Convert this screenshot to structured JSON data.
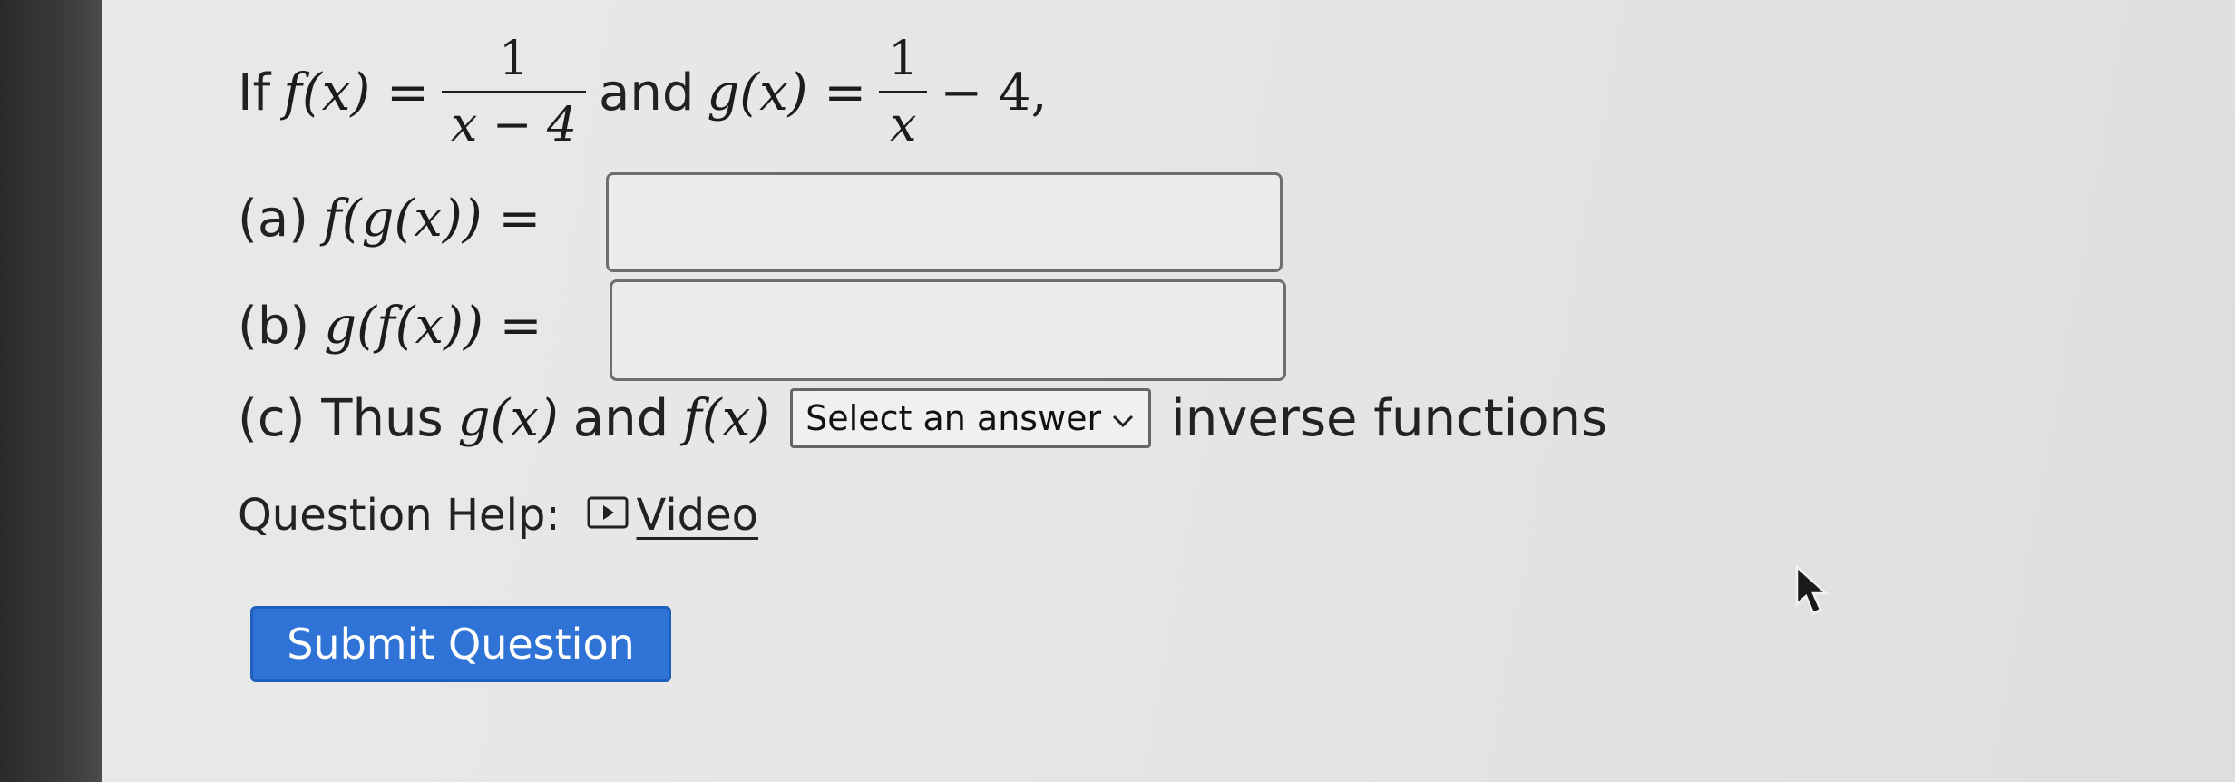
{
  "question": {
    "intro": "If",
    "f_def_lhs": "f(x) =",
    "f_def_num": "1",
    "f_def_den": "x − 4",
    "and_word": "and",
    "g_def_lhs": "g(x) =",
    "g_def_num": "1",
    "g_def_den": "x",
    "g_def_tail": "− 4,"
  },
  "part_a": {
    "label": "(a)",
    "expr": "f(g(x)) =",
    "answer_value": ""
  },
  "part_b": {
    "label": "(b)",
    "expr": "g(f(x)) =",
    "answer_value": ""
  },
  "part_c": {
    "label": "(c) Thus",
    "g_expr": "g(x)",
    "and_word": "and",
    "f_expr": "f(x)",
    "select_label": "Select an answer",
    "tail": "inverse functions"
  },
  "help": {
    "label": "Question Help:",
    "video_label": "Video",
    "video_icon": "play-box-icon"
  },
  "submit": {
    "label": "Submit Question",
    "color": "#2f73d6"
  },
  "cursor_icon": "mouse-pointer-icon"
}
